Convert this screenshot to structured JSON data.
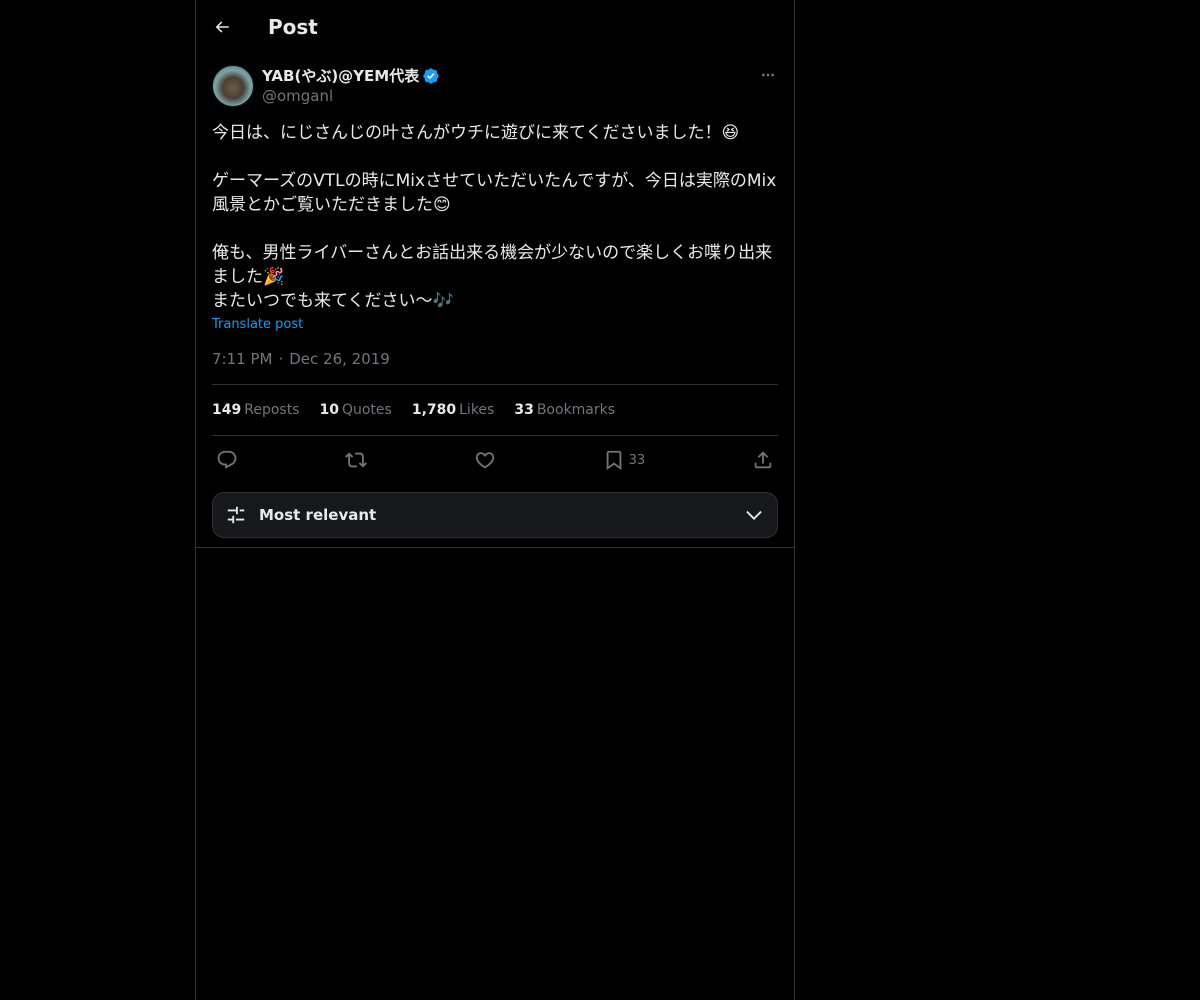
{
  "header": {
    "title": "Post"
  },
  "post": {
    "author": {
      "display_name": "YAB(やぶ)@YEM代表",
      "handle": "@omganl",
      "verified": true
    },
    "body": "今日は、にじさんじの叶さんがウチに遊びに来てくださいました！😆\n\nゲーマーズのVTLの時にMixさせていただいたんですが、今日は実際のMix風景とかご覧いただきました😊\n\n俺も、男性ライバーさんとお話出来る機会が少ないので楽しくお喋り出来ました🎉\nまたいつでも来てください〜🎶",
    "translate_label": "Translate post",
    "time": "7:11 PM",
    "date": "Dec 26, 2019",
    "stats": {
      "reposts": {
        "count": "149",
        "label": "Reposts"
      },
      "quotes": {
        "count": "10",
        "label": "Quotes"
      },
      "likes": {
        "count": "1,780",
        "label": "Likes"
      },
      "bookmarks": {
        "count": "33",
        "label": "Bookmarks"
      }
    },
    "actions": {
      "reply": {
        "icon": "reply-icon"
      },
      "repost": {
        "icon": "repost-icon"
      },
      "like": {
        "icon": "heart-icon"
      },
      "bookmark": {
        "icon": "bookmark-icon",
        "count": "33"
      },
      "share": {
        "icon": "share-icon"
      }
    }
  },
  "replies": {
    "sort_label": "Most relevant"
  },
  "colors": {
    "background": "#000000",
    "text": "#e7e9ea",
    "muted": "#71767b",
    "accent": "#1d9bf0",
    "border": "#2f3336"
  }
}
